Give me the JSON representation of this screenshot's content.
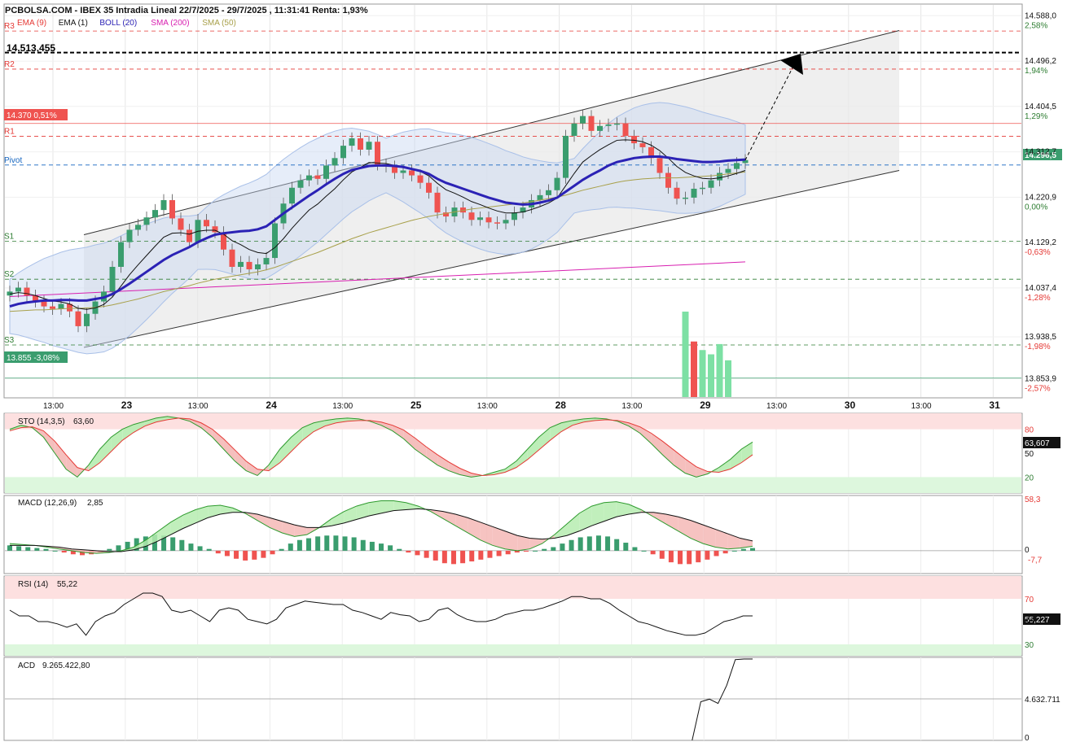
{
  "header": {
    "title": "PCBOLSA.COM - IBEX 35 Intradia Lineal 22/7/2025 - 29/7/2025 , 11:31:41 Renta: 1,93%",
    "legend": [
      {
        "label": "EMA (9)",
        "color": "#e53935"
      },
      {
        "label": "EMA (1)",
        "color": "#111111"
      },
      {
        "label": "BOLL (20)",
        "color": "#2b22b5"
      },
      {
        "label": "SMA (200)",
        "color": "#d81fb0"
      },
      {
        "label": "SMA (50)",
        "color": "#a8a04a"
      }
    ]
  },
  "price_panel": {
    "levels": [
      {
        "label": "R3",
        "value": 14557,
        "color": "#e53935"
      },
      {
        "label": "R2",
        "value": 14480,
        "color": "#e53935"
      },
      {
        "label": "R1",
        "value": 14344,
        "color": "#e53935"
      },
      {
        "label": "Pivot",
        "value": 14286,
        "color": "#1565c0"
      },
      {
        "label": "S1",
        "value": 14132,
        "color": "#2e7d32"
      },
      {
        "label": "S2",
        "value": 14055,
        "color": "#2e7d32"
      },
      {
        "label": "S3",
        "value": 13922,
        "color": "#2e7d32"
      }
    ],
    "target_label": "14.513,455",
    "target_value": 14513.455,
    "badge_high": "14.370  0,51%",
    "badge_high_value": 14370,
    "badge_low": "13.855  -3,08%",
    "badge_low_value": 13855,
    "last_price_badge": "14.296,5",
    "y_ticks": [
      {
        "price": "14.588,0",
        "pct": "2,58%"
      },
      {
        "price": "14.496,2",
        "pct": "1,94%"
      },
      {
        "price": "14.404,5",
        "pct": "1,29%"
      },
      {
        "price": "14.312,7",
        "pct": ""
      },
      {
        "price": "14.220,9",
        "pct": "0,00%"
      },
      {
        "price": "14.129,2",
        "pct": "-0,63%"
      },
      {
        "price": "14.037,4",
        "pct": "-1,28%"
      },
      {
        "price": "13.938,5",
        "pct": "-1,98%"
      },
      {
        "price": "13.853,9",
        "pct": "-2,57%"
      }
    ],
    "x_ticks": [
      "13:00",
      "23",
      "13:00",
      "24",
      "13:00",
      "25",
      "13:00",
      "28",
      "13:00",
      "29",
      "13:00",
      "30",
      "13:00",
      "31"
    ]
  },
  "indicators": {
    "sto": {
      "label": "STO (14,3,5)",
      "value": "63,60",
      "badge": "63,607",
      "ticks": [
        "80",
        "50",
        "20"
      ]
    },
    "macd": {
      "label": "MACD (12,26,9)",
      "value": "2,85",
      "ticks": [
        "58,3",
        "0",
        "-7,7"
      ]
    },
    "rsi": {
      "label": "RSI (14)",
      "value": "55,22",
      "badge": "55,227",
      "ticks": [
        "70",
        "50",
        "30"
      ]
    },
    "acd": {
      "label": "ACD",
      "value": "9.265.422,80",
      "ticks": [
        "4.632.711",
        "0"
      ]
    }
  },
  "colors": {
    "up": "#3a9d6e",
    "down": "#ef5350",
    "boll": "#2b22b5",
    "sma200": "#d81fb0",
    "sma50": "#a8a04a"
  },
  "chart_data": {
    "type": "candlestick",
    "title": "IBEX 35 Intradia Lineal 22/7/2025 - 29/7/2025",
    "ylim": [
      13820,
      14600
    ],
    "ohlc_close": [
      14030,
      14038,
      14022,
      14010,
      14000,
      13995,
      14005,
      13990,
      13960,
      13985,
      14010,
      14030,
      14080,
      14130,
      14155,
      14165,
      14180,
      14195,
      14215,
      14178,
      14155,
      14130,
      14175,
      14162,
      14150,
      14115,
      14080,
      14090,
      14075,
      14085,
      14098,
      14168,
      14208,
      14240,
      14255,
      14265,
      14258,
      14285,
      14300,
      14325,
      14340,
      14317,
      14333,
      14287,
      14283,
      14270,
      14275,
      14265,
      14250,
      14230,
      14190,
      14182,
      14200,
      14190,
      14175,
      14180,
      14170,
      14168,
      14175,
      14190,
      14200,
      14215,
      14225,
      14235,
      14260,
      14345,
      14370,
      14385,
      14355,
      14365,
      14368,
      14370,
      14345,
      14330,
      14322,
      14300,
      14270,
      14240,
      14218,
      14220,
      14238,
      14240,
      14255,
      14270,
      14278,
      14290,
      14296
    ],
    "ema9": [
      14025,
      14028,
      14026,
      14022,
      14016,
      14011,
      14009,
      14005,
      13996,
      13994,
      13997,
      14004,
      14019,
      14041,
      14064,
      14084,
      14103,
      14122,
      14140,
      14148,
      14149,
      14146,
      14152,
      14154,
      14154,
      14146,
      14133,
      14125,
      14115,
      14109,
      14107,
      14119,
      14137,
      14158,
      14177,
      14195,
      14207,
      14223,
      14238,
      14256,
      14272,
      14281,
      14291,
      14290,
      14289,
      14285,
      14283,
      14279,
      14273,
      14264,
      14249,
      14236,
      14229,
      14221,
      14212,
      14206,
      14199,
      14193,
      14189,
      14189,
      14191,
      14196,
      14202,
      14209,
      14219,
      14244,
      14269,
      14292,
      14305,
      14317,
      14327,
      14336,
      14337,
      14336,
      14333,
      14326,
      14315,
      14300,
      14283,
      14271,
      14264,
      14259,
      14258,
      14260,
      14264,
      14269,
      14275
    ],
    "boll_mid": [
      14000,
      14005,
      14008,
      14010,
      14012,
      14012,
      14013,
      14013,
      14012,
      14012,
      14015,
      14018,
      14025,
      14035,
      14046,
      14058,
      14070,
      14082,
      14094,
      14104,
      14112,
      14120,
      14130,
      14138,
      14145,
      14148,
      14150,
      14152,
      14153,
      14156,
      14162,
      14175,
      14188,
      14200,
      14212,
      14224,
      14235,
      14247,
      14258,
      14268,
      14276,
      14280,
      14284,
      14285,
      14285,
      14284,
      14282,
      14278,
      14274,
      14268,
      14258,
      14250,
      14244,
      14238,
      14232,
      14226,
      14220,
      14215,
      14210,
      14208,
      14206,
      14207,
      14210,
      14214,
      14220,
      14232,
      14244,
      14256,
      14266,
      14275,
      14285,
      14292,
      14296,
      14300,
      14302,
      14303,
      14303,
      14301,
      14298,
      14296,
      14294,
      14292,
      14292,
      14293,
      14295,
      14296,
      14297
    ],
    "sma50": [
      13990,
      13991,
      13992,
      13993,
      13993,
      13994,
      13995,
      13996,
      13996,
      13997,
      13998,
      14000,
      14003,
      14007,
      14011,
      14015,
      14020,
      14025,
      14030,
      14034,
      14038,
      14042,
      14047,
      14051,
      14055,
      14058,
      14061,
      14064,
      14067,
      14070,
      14074,
      14079,
      14085,
      14091,
      14097,
      14103,
      14109,
      14116,
      14123,
      14130,
      14137,
      14143,
      14149,
      14154,
      14159,
      14164,
      14169,
      14174,
      14178,
      14182,
      14185,
      14188,
      14191,
      14194,
      14197,
      14199,
      14201,
      14203,
      14205,
      14207,
      14209,
      14212,
      14215,
      14218,
      14221,
      14225,
      14230,
      14235,
      14239,
      14243,
      14247,
      14251,
      14254,
      14256,
      14258,
      14259,
      14260,
      14260,
      14260,
      14261,
      14262,
      14263,
      14264,
      14266,
      14268,
      14270,
      14272
    ],
    "sma200_range": [
      14020,
      14090
    ],
    "volume": [
      0,
      0,
      0,
      0,
      0,
      0,
      0,
      0,
      0,
      0,
      0,
      0,
      0,
      0,
      0,
      0,
      0,
      0,
      0,
      0,
      0,
      0,
      0,
      0,
      0,
      0,
      0,
      0,
      0,
      0,
      0,
      0,
      0,
      0,
      0,
      0,
      0,
      0,
      0,
      0,
      0,
      0,
      0,
      0,
      0,
      0,
      0,
      0,
      0,
      0,
      0,
      0,
      0,
      0,
      0,
      0,
      0,
      0,
      0,
      0,
      0,
      0,
      0,
      0,
      0,
      0,
      0,
      0,
      0,
      0,
      0,
      0,
      0,
      0,
      0,
      0,
      0,
      0,
      0,
      100,
      65,
      55,
      50,
      62,
      43,
      0,
      0
    ],
    "sto_k": [
      80,
      85,
      82,
      70,
      50,
      30,
      20,
      35,
      55,
      70,
      80,
      86,
      90,
      94,
      96,
      94,
      90,
      82,
      70,
      55,
      40,
      28,
      22,
      35,
      55,
      70,
      82,
      88,
      91,
      93,
      94,
      93,
      90,
      85,
      78,
      68,
      55,
      45,
      35,
      28,
      23,
      20,
      22,
      26,
      30,
      40,
      55,
      70,
      82,
      88,
      91,
      93,
      94,
      93,
      90,
      84,
      75,
      62,
      48,
      35,
      25,
      20,
      24,
      32,
      42,
      55,
      64
    ],
    "sto_d": [
      78,
      82,
      83,
      78,
      65,
      48,
      32,
      28,
      38,
      52,
      66,
      76,
      84,
      89,
      92,
      94,
      93,
      88,
      80,
      68,
      54,
      40,
      30,
      28,
      38,
      52,
      66,
      77,
      84,
      88,
      90,
      91,
      91,
      89,
      85,
      79,
      69,
      58,
      48,
      39,
      31,
      25,
      22,
      23,
      26,
      32,
      42,
      54,
      66,
      77,
      85,
      89,
      91,
      92,
      91,
      88,
      83,
      75,
      65,
      54,
      43,
      33,
      27,
      26,
      30,
      38,
      48
    ],
    "macd_hist": [
      6,
      5,
      4,
      3,
      2,
      0,
      -2,
      -4,
      -5,
      -4,
      -2,
      2,
      6,
      10,
      14,
      16,
      18,
      17,
      15,
      12,
      8,
      5,
      2,
      -3,
      -6,
      -9,
      -11,
      -10,
      -8,
      -4,
      2,
      8,
      12,
      14,
      16,
      17,
      17,
      16,
      15,
      12,
      10,
      8,
      6,
      2,
      -2,
      -5,
      -8,
      -11,
      -14,
      -15,
      -14,
      -12,
      -10,
      -8,
      -6,
      -4,
      -2,
      -1,
      0,
      2,
      4,
      8,
      12,
      15,
      16,
      17,
      16,
      13,
      9,
      4,
      0,
      -4,
      -9,
      -13,
      -15,
      -15,
      -13,
      -10,
      -6,
      -3,
      0,
      2,
      3
    ],
    "macd_line": [
      8,
      7,
      6,
      4,
      2,
      0,
      -2,
      -3,
      -2,
      0,
      4,
      12,
      22,
      32,
      40,
      46,
      50,
      51,
      48,
      42,
      34,
      26,
      20,
      16,
      18,
      26,
      36,
      44,
      50,
      54,
      56,
      56,
      54,
      50,
      44,
      36,
      28,
      20,
      12,
      6,
      2,
      0,
      2,
      8,
      18,
      30,
      42,
      50,
      54,
      55,
      52,
      46,
      38,
      30,
      22,
      14,
      8,
      4,
      2,
      3,
      5
    ],
    "macd_signal": [
      6,
      6,
      6,
      5,
      4,
      2,
      1,
      0,
      -1,
      -1,
      1,
      5,
      11,
      18,
      25,
      31,
      37,
      41,
      43,
      43,
      41,
      37,
      33,
      29,
      26,
      26,
      28,
      31,
      35,
      39,
      42,
      45,
      46,
      47,
      46,
      44,
      41,
      37,
      32,
      27,
      22,
      17,
      14,
      13,
      14,
      17,
      22,
      28,
      33,
      38,
      41,
      43,
      43,
      41,
      38,
      34,
      29,
      24,
      19,
      14,
      11
    ],
    "rsi": [
      60,
      55,
      55,
      50,
      50,
      48,
      45,
      48,
      38,
      50,
      55,
      58,
      65,
      70,
      75,
      75,
      72,
      60,
      58,
      60,
      55,
      50,
      60,
      62,
      60,
      52,
      50,
      48,
      52,
      62,
      65,
      68,
      67,
      66,
      65,
      65,
      60,
      58,
      55,
      52,
      58,
      56,
      55,
      50,
      52,
      60,
      62,
      56,
      52,
      50,
      50,
      52,
      56,
      58,
      60,
      60,
      62,
      65,
      68,
      72,
      72,
      70,
      70,
      66,
      60,
      55,
      50,
      48,
      45,
      42,
      40,
      38,
      38,
      40,
      45,
      50,
      52,
      55,
      55
    ],
    "acd": [
      0,
      0,
      0,
      0,
      0,
      0,
      0,
      0,
      0,
      0,
      0,
      0,
      0,
      0,
      0,
      0,
      0,
      0,
      0,
      0,
      0,
      0,
      0,
      0,
      0,
      0,
      0,
      0,
      0,
      0,
      0,
      0,
      0,
      0,
      0,
      0,
      0,
      0,
      0,
      0,
      0,
      0,
      0,
      0,
      0,
      0,
      0,
      0,
      0,
      0,
      0,
      0,
      0,
      0,
      0,
      0,
      0,
      0,
      0,
      0,
      0,
      0,
      0,
      0,
      0,
      0,
      0,
      0,
      0,
      0,
      0,
      0,
      0,
      0,
      0,
      0,
      0,
      0,
      0,
      0,
      4300000,
      4600000,
      4100000,
      6200000,
      9200000,
      9265422,
      9265422
    ]
  }
}
